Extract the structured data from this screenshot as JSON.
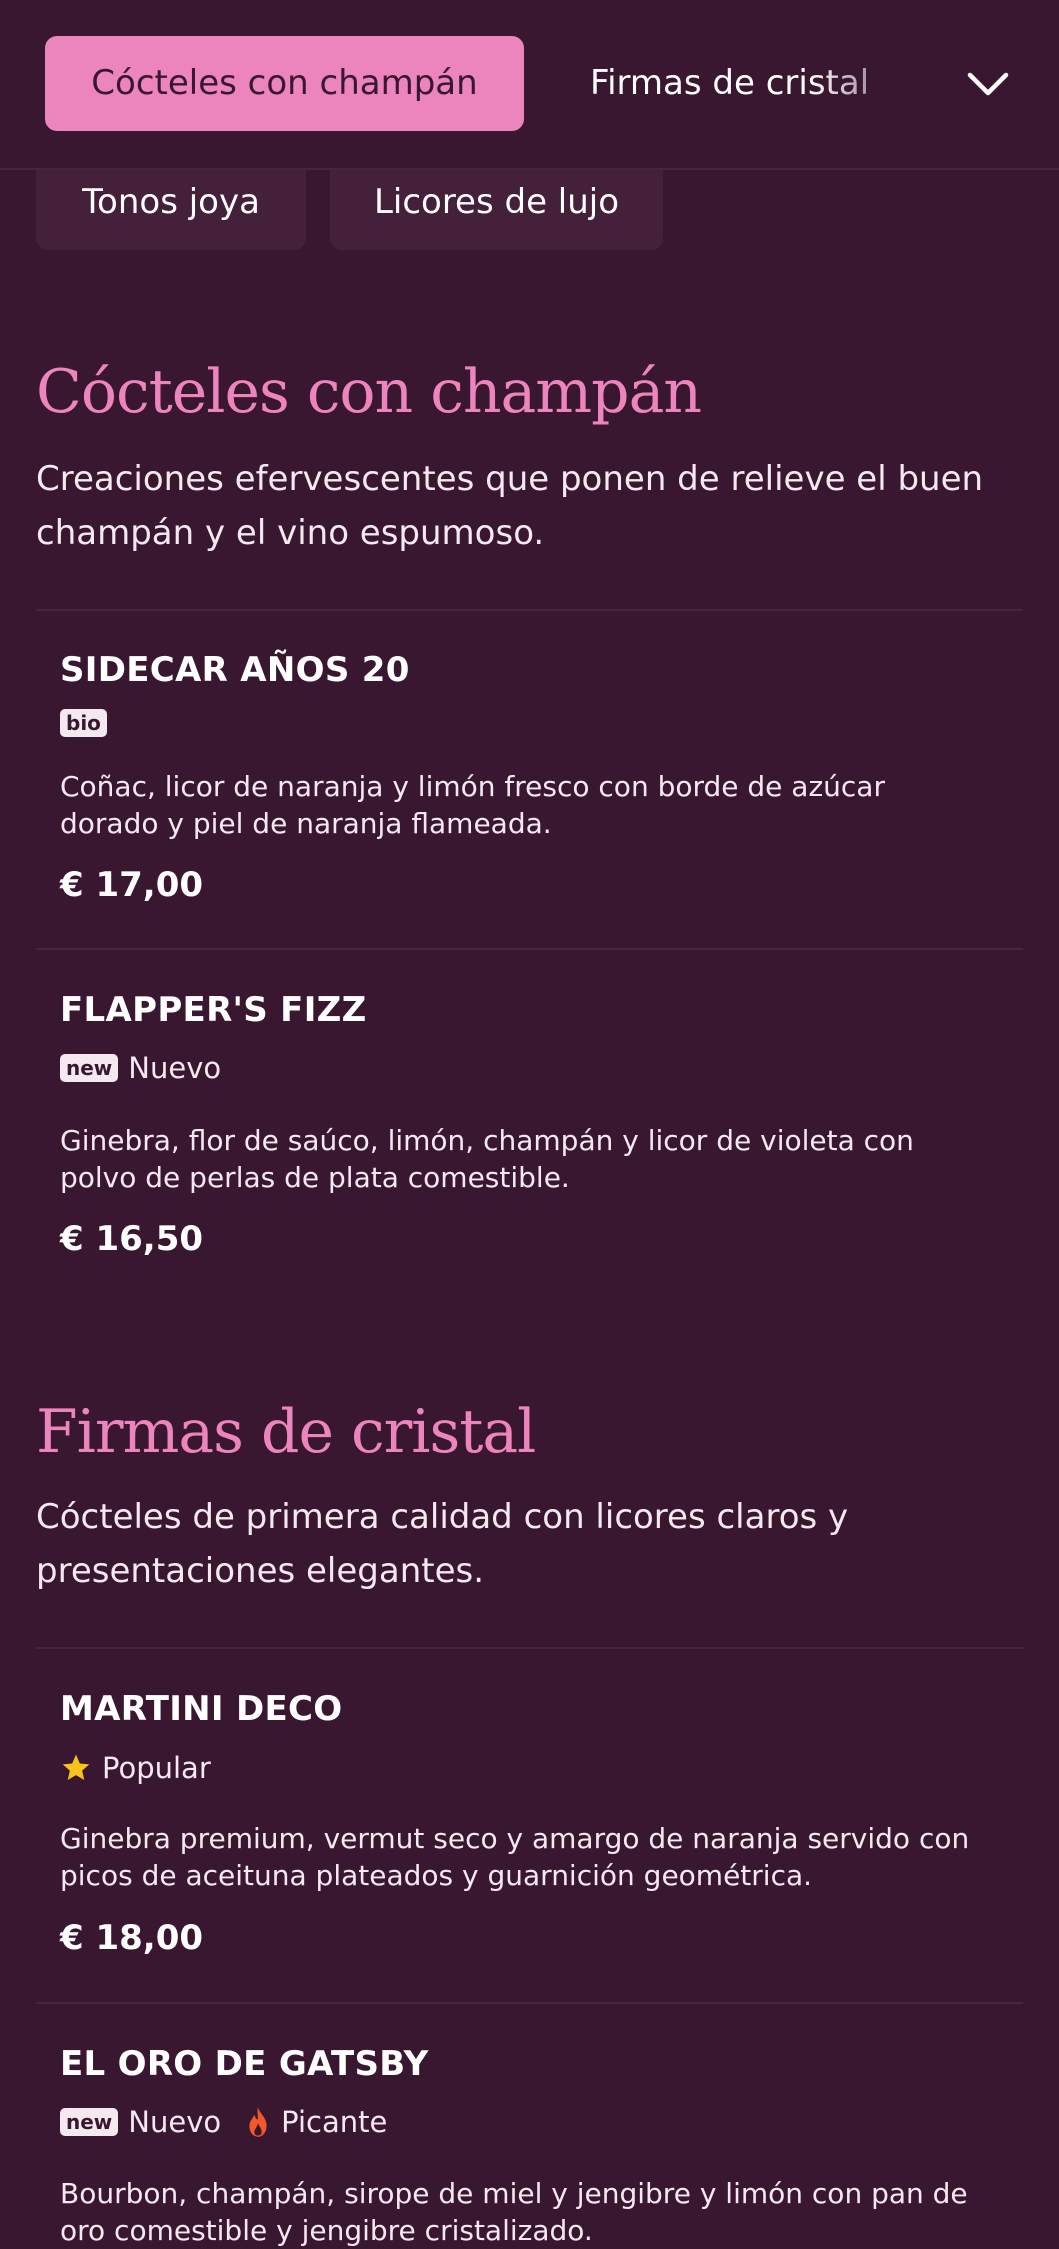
{
  "nav": {
    "active_tab": "Cócteles con champán",
    "next_tab": "Firmas de cristal",
    "chips": [
      "Tonos joya",
      "Licores de lujo"
    ]
  },
  "sections": [
    {
      "title": "Cócteles con champán",
      "description": "Creaciones efervescentes que ponen de relieve el buen champán y el vino espumoso.",
      "items": [
        {
          "name": "SIDECAR AÑOS 20",
          "badge": "bio",
          "description": "Coñac, licor de naranja y limón fresco con borde de azúcar dorado y piel de naranja flameada.",
          "price": "€ 17,00"
        },
        {
          "name": "FLAPPER'S FIZZ",
          "badge": "new",
          "tag": "Nuevo",
          "description": "Ginebra, flor de saúco, limón, champán y licor de violeta con polvo de perlas de plata comestible.",
          "price": "€ 16,50"
        }
      ]
    },
    {
      "title": "Firmas de cristal",
      "description": "Cócteles de primera calidad con licores claros y presentaciones elegantes.",
      "items": [
        {
          "name": "MARTINI DECO",
          "tag": "Popular",
          "description": "Ginebra premium, vermut seco y amargo de naranja servido con picos de aceituna plateados y guarnición geométrica.",
          "price": "€ 18,00"
        },
        {
          "name": "EL ORO DE GATSBY",
          "badge": "new",
          "tag": "Nuevo",
          "tag2": "Picante",
          "description": "Bourbon, champán, sirope de miel y jengibre y limón con pan de oro comestible y jengibre cristalizado."
        }
      ]
    }
  ],
  "colors": {
    "background": "#3a1730",
    "accent": "#ec84bd",
    "star": "#f6c21c",
    "flame": "#f05a28"
  }
}
